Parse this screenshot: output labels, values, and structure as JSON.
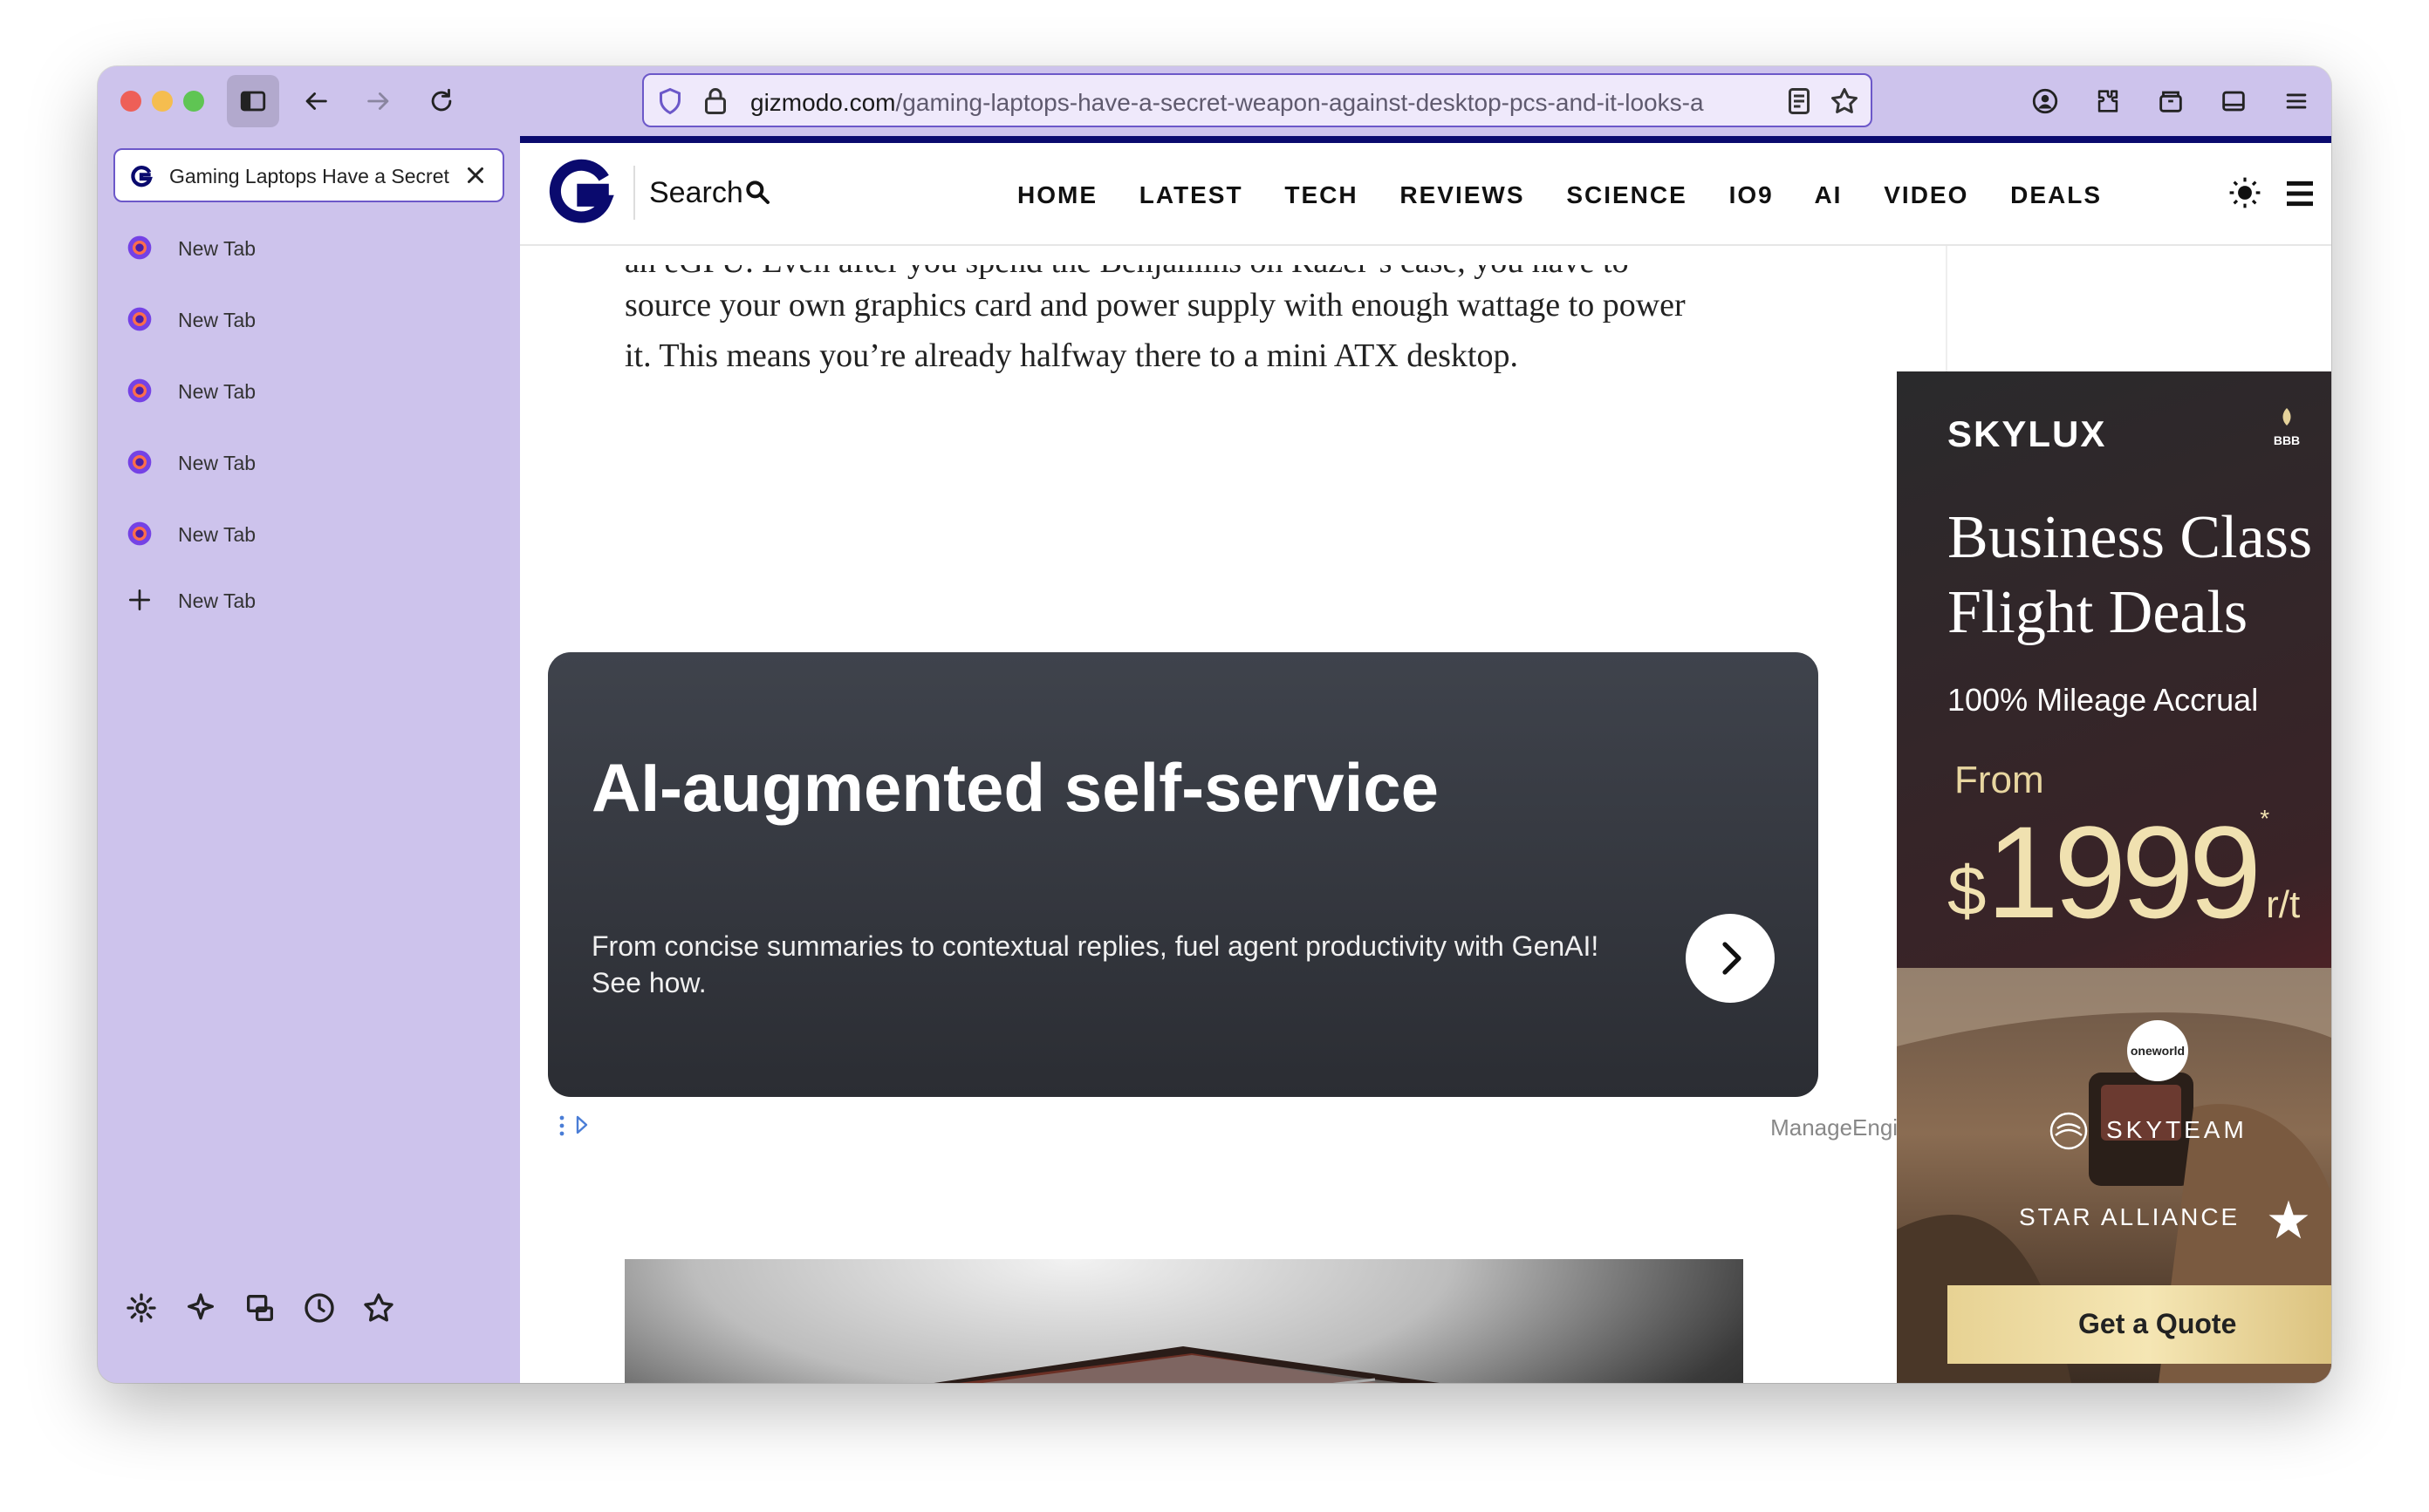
{
  "browser": {
    "url_host": "gizmodo.com",
    "url_path": "/gaming-laptops-have-a-secret-weapon-against-desktop-pcs-and-it-looks-a"
  },
  "sidebar": {
    "active_tab": {
      "title": "Gaming Laptops Have a Secret Weapon Against Desktop PCs"
    },
    "tabs": [
      {
        "label": "New Tab"
      },
      {
        "label": "New Tab"
      },
      {
        "label": "New Tab"
      },
      {
        "label": "New Tab"
      },
      {
        "label": "New Tab"
      }
    ],
    "new_tab_label": "New Tab"
  },
  "site": {
    "search_label": "Search",
    "nav": [
      "HOME",
      "LATEST",
      "TECH",
      "REVIEWS",
      "SCIENCE",
      "IO9",
      "AI",
      "VIDEO",
      "DEALS"
    ]
  },
  "article": {
    "lines": [
      "an eGPU. Even after you spend the Benjamins on Razer’s case, you have to",
      "source your own graphics card and power supply with enough wattage to power",
      "it. This means you’re already halfway there to a mini ATX desktop."
    ]
  },
  "inline_ad": {
    "title": "AI-augmented self-service",
    "body": "From concise summaries to contextual replies, fuel agent productivity with GenAI! See how.",
    "sponsor": "ManageEngine"
  },
  "side_ad": {
    "brand": "SKYLUX",
    "headline_1": "Business Class",
    "headline_2": "Flight Deals",
    "sub": "100% Mileage Accrual",
    "from": "From",
    "currency": "$",
    "price": "1999",
    "asterisk": "*",
    "unit": "r/t",
    "oneworld": "oneworld",
    "skyteam": "SKYTEAM",
    "star_alliance": "STAR ALLIANCE",
    "cta": "Get a Quote"
  },
  "colors": {
    "sidebar_bg": "#cdc3ec",
    "accent": "#6c58c9",
    "site_brand": "#0a0a6e"
  }
}
